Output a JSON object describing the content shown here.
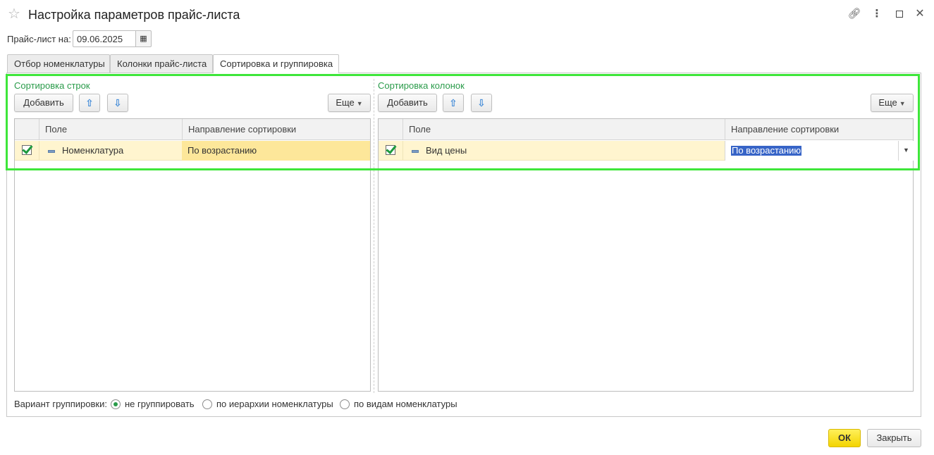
{
  "window": {
    "title": "Настройка параметров прайс-листа",
    "star_icon": "star-icon",
    "toolbar_icons": [
      "link-icon",
      "more-vertical-icon",
      "maximize-icon",
      "close-icon"
    ]
  },
  "date_row": {
    "label": "Прайс-лист на:",
    "value": "09.06.2025",
    "calendar_icon": "calendar-icon"
  },
  "tabs": [
    {
      "label": "Отбор номенклатуры",
      "active": false
    },
    {
      "label": "Колонки прайс-листа",
      "active": false
    },
    {
      "label": "Сортировка и группировка",
      "active": true
    }
  ],
  "rows_sort": {
    "title": "Сортировка строк",
    "add_label": "Добавить",
    "more_label": "Еще",
    "columns": [
      "Поле",
      "Направление сортировки"
    ],
    "rows": [
      {
        "checked": true,
        "field": "Номенклатура",
        "direction": "По возрастанию"
      }
    ]
  },
  "cols_sort": {
    "title": "Сортировка колонок",
    "add_label": "Добавить",
    "more_label": "Еще",
    "columns": [
      "Поле",
      "Направление сортировки"
    ],
    "rows": [
      {
        "checked": true,
        "field": "Вид цены",
        "direction": "По возрастанию"
      }
    ]
  },
  "grouping": {
    "label": "Вариант группировки:",
    "options": [
      {
        "label": "не группировать",
        "selected": true
      },
      {
        "label": "по иерархии номенклатуры",
        "selected": false
      },
      {
        "label": "по видам номенклатуры",
        "selected": false
      }
    ]
  },
  "footer": {
    "ok_label": "ОК",
    "close_label": "Закрыть"
  },
  "colors": {
    "accent_green": "#2a9b4a",
    "highlight_frame": "#3ee63a",
    "ok_yellow": "#f3d400",
    "row_selected": "#fff5cf",
    "text_selection": "#3764c7"
  }
}
